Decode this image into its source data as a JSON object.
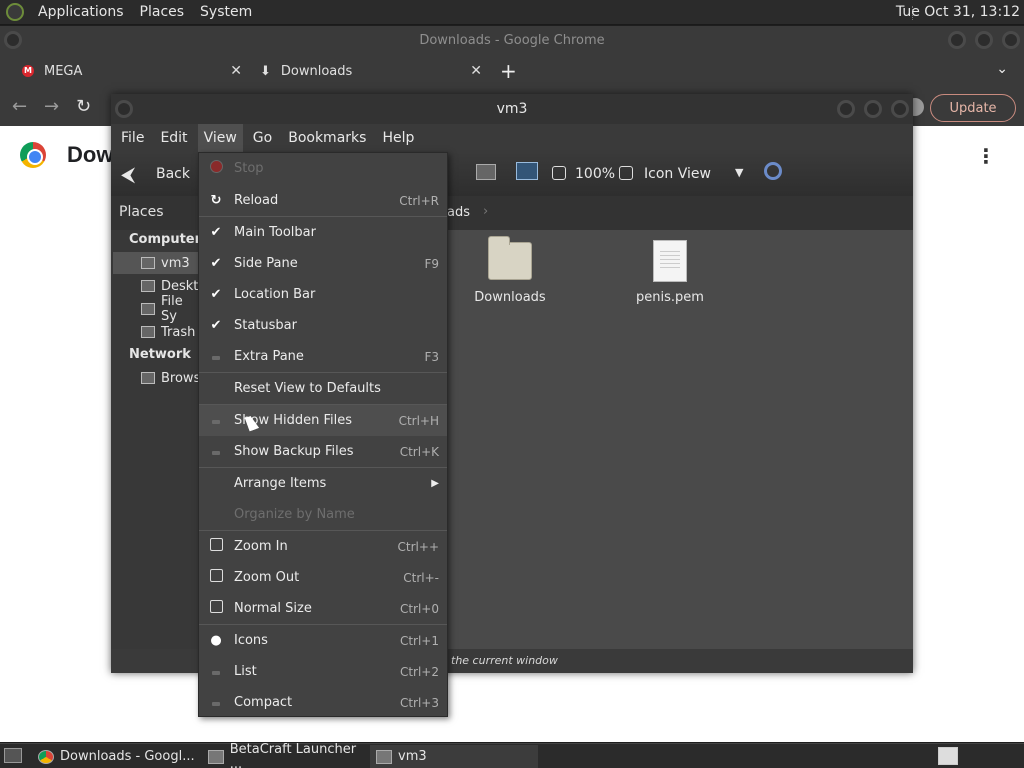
{
  "top_panel": {
    "menus": [
      "Applications",
      "Places",
      "System"
    ],
    "clock": "Tue Oct 31, 13:12"
  },
  "chrome": {
    "window_title": "Downloads - Google Chrome",
    "tabs": [
      {
        "label": "MEGA"
      },
      {
        "label": "Downloads"
      }
    ],
    "new_tab": "+",
    "update_label": "Update",
    "page_title": "Dow"
  },
  "vm3": {
    "title": "vm3",
    "menubar": [
      "File",
      "Edit",
      "View",
      "Go",
      "Bookmarks",
      "Help"
    ],
    "toolbar": {
      "back_label": "Back",
      "zoom": "100%",
      "view_mode": "Icon View"
    },
    "location": {
      "crumb": "ads"
    },
    "sidebar": {
      "places_label": "Places",
      "computer_label": "Computer",
      "network_label": "Network",
      "computer_items": [
        "vm3",
        "Deskt",
        "File Sy",
        "Trash"
      ],
      "network_items": [
        "Brows"
      ]
    },
    "files": [
      {
        "name": "Downloads",
        "kind": "folder"
      },
      {
        "name": "penis.pem",
        "kind": "document"
      }
    ],
    "status": "the current window"
  },
  "view_menu": {
    "items": [
      {
        "label": "Stop",
        "accel": "",
        "mark": "stop",
        "disabled": true
      },
      {
        "label": "Reload",
        "accel": "Ctrl+R",
        "mark": "reload",
        "disabled": false
      },
      {
        "label": "Main Toolbar",
        "accel": "",
        "mark": "check",
        "disabled": false
      },
      {
        "label": "Side Pane",
        "accel": "F9",
        "mark": "check",
        "disabled": false
      },
      {
        "label": "Location Bar",
        "accel": "",
        "mark": "check",
        "disabled": false
      },
      {
        "label": "Statusbar",
        "accel": "",
        "mark": "check",
        "disabled": false
      },
      {
        "label": "Extra Pane",
        "accel": "F3",
        "mark": "dash",
        "disabled": false
      },
      {
        "label": "Reset View to Defaults",
        "accel": "",
        "mark": "",
        "disabled": false
      },
      {
        "label": "Show Hidden Files",
        "accel": "Ctrl+H",
        "mark": "dash",
        "disabled": false
      },
      {
        "label": "Show Backup Files",
        "accel": "Ctrl+K",
        "mark": "dash",
        "disabled": false
      },
      {
        "label": "Arrange Items",
        "accel": "",
        "mark": "",
        "disabled": false
      },
      {
        "label": "Organize by Name",
        "accel": "",
        "mark": "",
        "disabled": true
      },
      {
        "label": "Zoom In",
        "accel": "Ctrl++",
        "mark": "zoom-in",
        "disabled": false
      },
      {
        "label": "Zoom Out",
        "accel": "Ctrl+-",
        "mark": "zoom-out",
        "disabled": false
      },
      {
        "label": "Normal Size",
        "accel": "Ctrl+0",
        "mark": "zoom-normal",
        "disabled": false
      },
      {
        "label": "Icons",
        "accel": "Ctrl+1",
        "mark": "radio-on",
        "disabled": false
      },
      {
        "label": "List",
        "accel": "Ctrl+2",
        "mark": "dash",
        "disabled": false
      },
      {
        "label": "Compact",
        "accel": "Ctrl+3",
        "mark": "dash",
        "disabled": false
      }
    ]
  },
  "taskbar": {
    "tasks": [
      {
        "label": "Downloads - Googl..."
      },
      {
        "label": "BetaCraft Launcher ..."
      },
      {
        "label": "vm3"
      }
    ]
  }
}
